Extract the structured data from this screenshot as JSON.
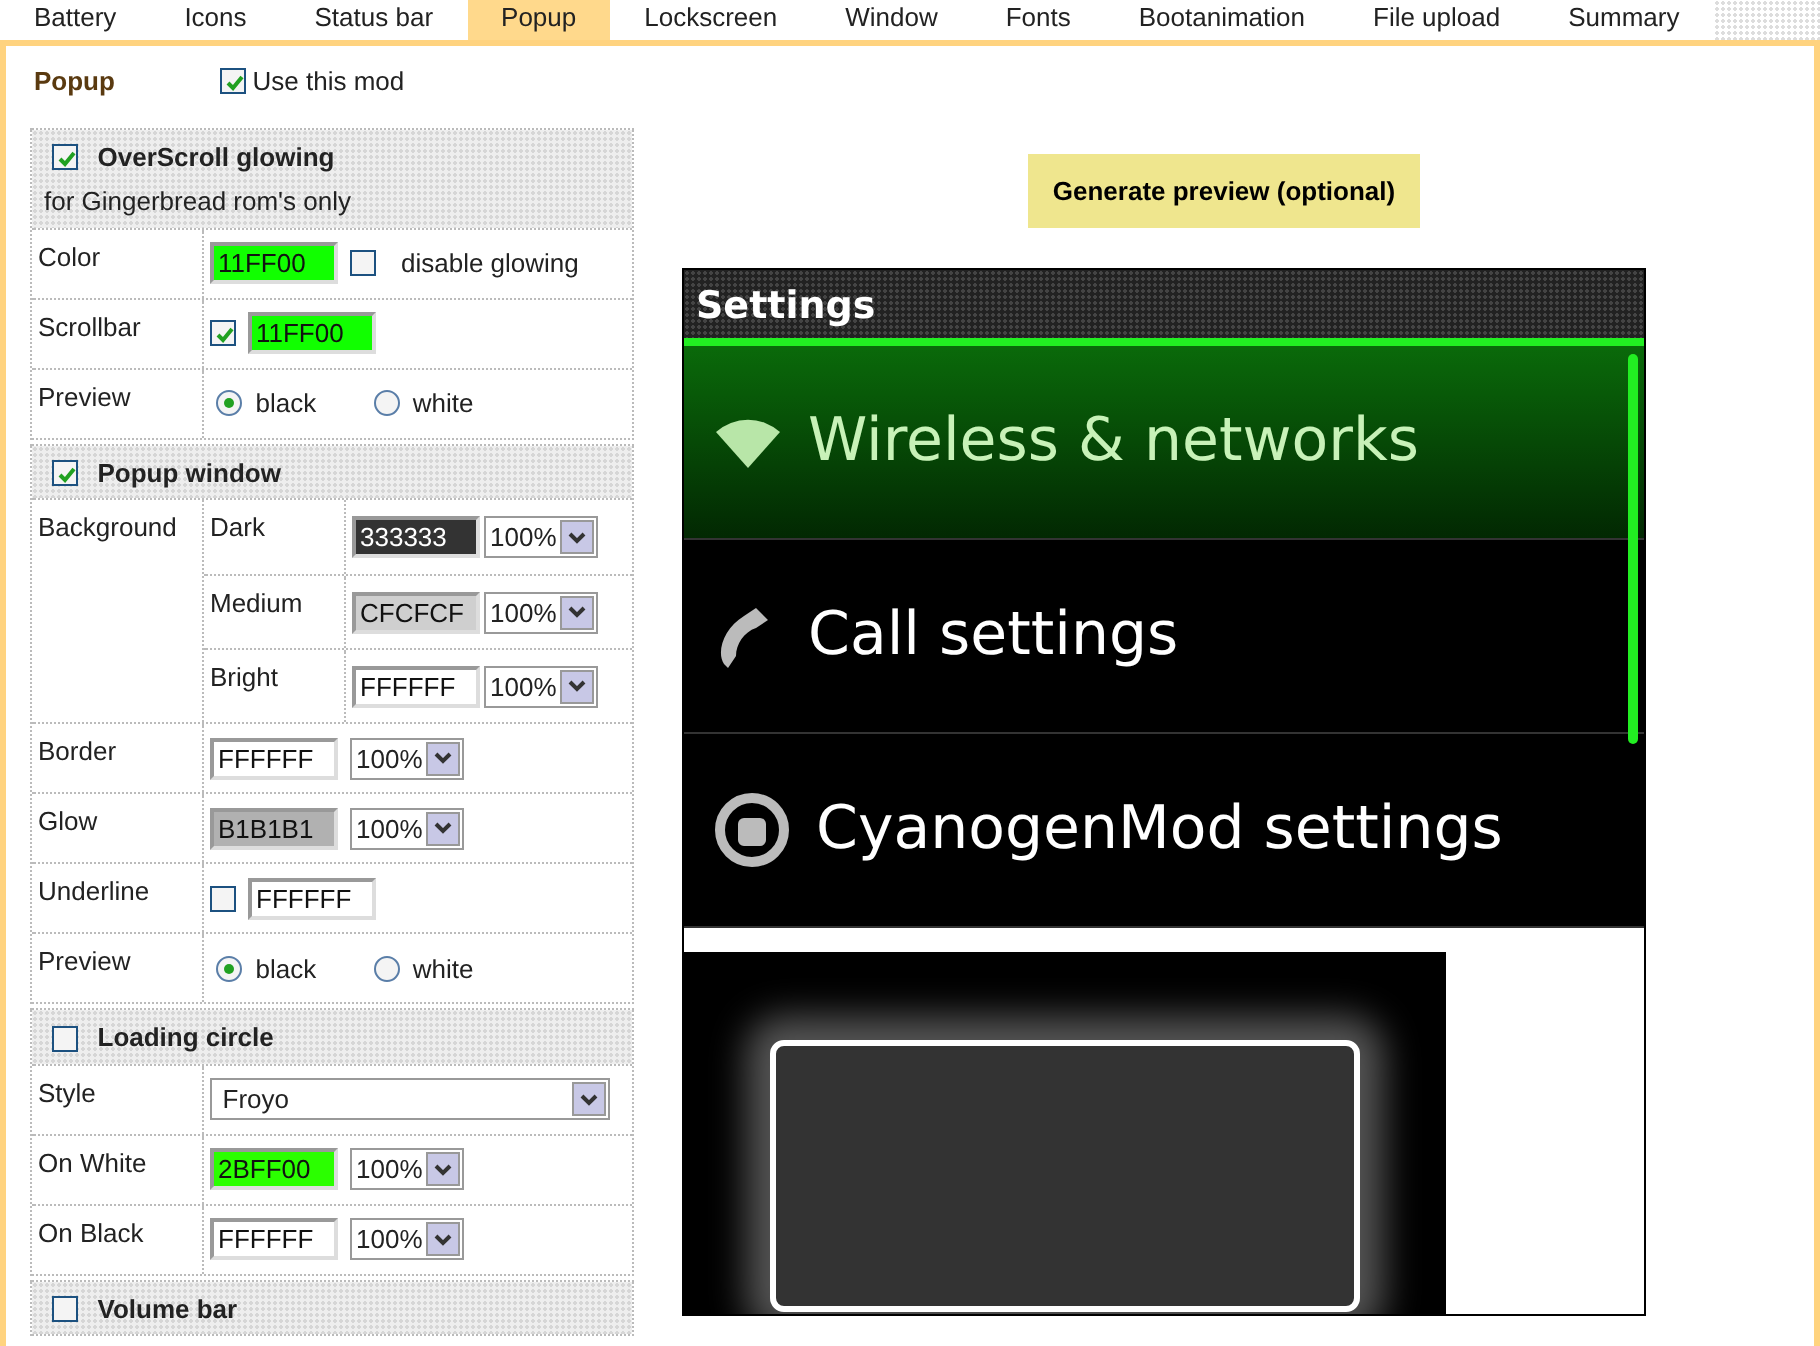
{
  "tabs": [
    {
      "label": "Battery",
      "selected": false
    },
    {
      "label": "Icons",
      "selected": false
    },
    {
      "label": "Status bar",
      "selected": false
    },
    {
      "label": "Popup",
      "selected": true
    },
    {
      "label": "Lockscreen",
      "selected": false
    },
    {
      "label": "Window",
      "selected": false
    },
    {
      "label": "Fonts",
      "selected": false
    },
    {
      "label": "Bootanimation",
      "selected": false
    },
    {
      "label": "File upload",
      "selected": false
    },
    {
      "label": "Summary",
      "selected": false
    }
  ],
  "mod": {
    "title": "Popup",
    "use_label": "Use this mod",
    "checked": true
  },
  "sections": [
    {
      "title": "OverScroll glowing",
      "checked": true,
      "note": "for Gingerbread rom's only",
      "rows": [
        {
          "label": "Color",
          "controls": [
            {
              "kind": "color",
              "value": "11FF00",
              "color": "#11ff00"
            },
            {
              "kind": "checkbox",
              "checked": false,
              "label": "disable glowing"
            }
          ]
        },
        {
          "label": "Scrollbar",
          "controls": [
            {
              "kind": "checkbox",
              "checked": true
            },
            {
              "kind": "color",
              "value": "11FF00",
              "color": "#11ff00"
            }
          ]
        },
        {
          "label": "Preview",
          "controls": [
            {
              "kind": "radio",
              "label": "black",
              "selected": true
            },
            {
              "kind": "radio",
              "label": "white",
              "selected": false
            }
          ]
        }
      ]
    },
    {
      "title": "Popup window",
      "checked": true,
      "rows": [
        {
          "label": "Background",
          "children": [
            {
              "label": "Dark",
              "controls": [
                {
                  "kind": "color",
                  "value": "333333",
                  "color": "#333333"
                },
                {
                  "kind": "percent",
                  "value": "100%"
                }
              ]
            },
            {
              "label": "Medium",
              "controls": [
                {
                  "kind": "color",
                  "value": "CFCFCF",
                  "color": "#cfcfcf"
                },
                {
                  "kind": "percent",
                  "value": "100%"
                }
              ]
            },
            {
              "label": "Bright",
              "controls": [
                {
                  "kind": "color",
                  "value": "FFFFFF",
                  "color": "#ffffff"
                },
                {
                  "kind": "percent",
                  "value": "100%"
                }
              ]
            }
          ]
        },
        {
          "label": "Border",
          "controls": [
            {
              "kind": "color",
              "value": "FFFFFF",
              "color": "#ffffff"
            },
            {
              "kind": "percent",
              "value": "100%"
            }
          ]
        },
        {
          "label": "Glow",
          "controls": [
            {
              "kind": "color",
              "value": "B1B1B1",
              "color": "#b1b1b1"
            },
            {
              "kind": "percent",
              "value": "100%"
            }
          ]
        },
        {
          "label": "Underline",
          "controls": [
            {
              "kind": "checkbox",
              "checked": false
            },
            {
              "kind": "color",
              "value": "FFFFFF",
              "color": "#ffffff"
            }
          ]
        },
        {
          "label": "Preview",
          "controls": [
            {
              "kind": "radio",
              "label": "black",
              "selected": true
            },
            {
              "kind": "radio",
              "label": "white",
              "selected": false
            }
          ]
        }
      ]
    },
    {
      "title": "Loading circle",
      "checked": false,
      "rows": [
        {
          "label": "Style",
          "controls": [
            {
              "kind": "select",
              "value": "Froyo"
            }
          ]
        },
        {
          "label": "On White",
          "controls": [
            {
              "kind": "color",
              "value": "2BFF00",
              "color": "#2bff00"
            },
            {
              "kind": "percent",
              "value": "100%"
            }
          ]
        },
        {
          "label": "On Black",
          "controls": [
            {
              "kind": "color",
              "value": "FFFFFF",
              "color": "#ffffff"
            },
            {
              "kind": "percent",
              "value": "100%"
            }
          ]
        }
      ]
    },
    {
      "title": "Volume bar",
      "checked": false
    }
  ],
  "preview": {
    "button": "Generate preview (optional)",
    "screen": {
      "title": "Settings",
      "items": [
        {
          "label": "Wireless & networks",
          "selected": true
        },
        {
          "label": "Call settings",
          "selected": false
        },
        {
          "label": "CyanogenMod settings",
          "selected": false
        }
      ]
    }
  }
}
